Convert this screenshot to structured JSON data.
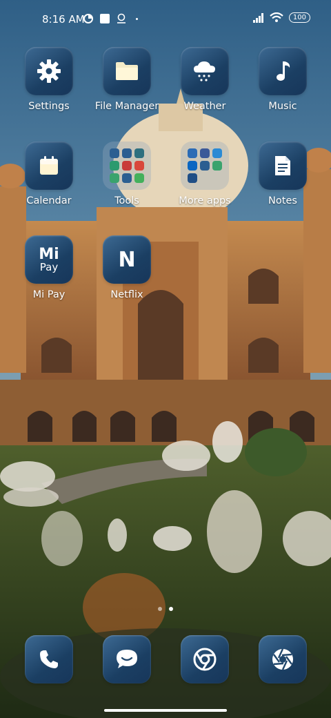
{
  "status_bar": {
    "time": "8:16 AM",
    "battery": "100"
  },
  "apps": {
    "settings": {
      "label": "Settings",
      "icon": "gear-icon"
    },
    "file_manager": {
      "label": "File Manager",
      "icon": "folder-icon"
    },
    "weather": {
      "label": "Weather",
      "icon": "snow-cloud-icon"
    },
    "music": {
      "label": "Music",
      "icon": "music-note-icon"
    },
    "calendar": {
      "label": "Calendar",
      "icon": "calendar-icon"
    },
    "notes": {
      "label": "Notes",
      "icon": "note-icon"
    },
    "mi_pay": {
      "label": "Mi Pay",
      "icon": "mi-pay-icon",
      "icon_text_top": "Mi",
      "icon_text_bottom": "Pay"
    },
    "netflix": {
      "label": "Netflix",
      "icon": "netflix-icon",
      "icon_text": "N"
    }
  },
  "folders": {
    "tools": {
      "label": "Tools"
    },
    "more_apps": {
      "label": "More apps"
    }
  },
  "dock": [
    "phone-icon",
    "messages-icon",
    "chrome-icon",
    "camera-icon"
  ],
  "page_indicator": {
    "pages": 2,
    "active": 2
  },
  "colors": {
    "tile_top": "#3d6a93",
    "tile_bottom": "#17365a",
    "sky": "#5d87a3"
  }
}
